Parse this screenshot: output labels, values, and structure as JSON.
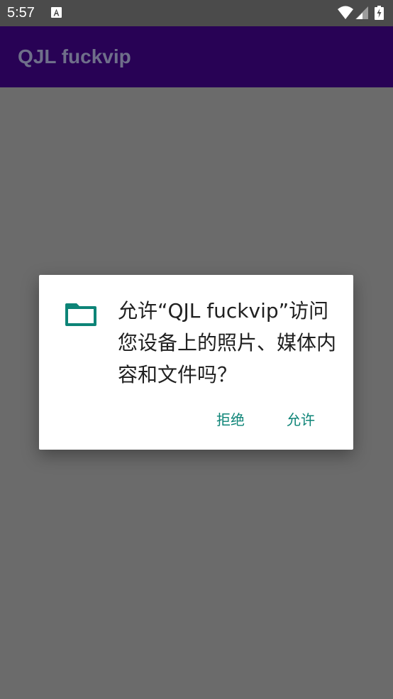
{
  "status_bar": {
    "time": "5:57",
    "icons": [
      "a-notification-icon",
      "wifi-icon",
      "signal-icon",
      "battery-charging-icon"
    ]
  },
  "app_bar": {
    "title": "QJL fuckvip"
  },
  "dialog": {
    "message": "允许“QJL fuckvip”访问您设备上的照片、媒体内容和文件吗？",
    "icon": "folder-icon",
    "deny_label": "拒绝",
    "allow_label": "允许",
    "accent_color": "#0d8477"
  },
  "colors": {
    "status_bar": "#4b4b4b",
    "app_bar": "#280255",
    "scrim_background": "#6b6b6b",
    "dialog_background": "#ffffff"
  }
}
